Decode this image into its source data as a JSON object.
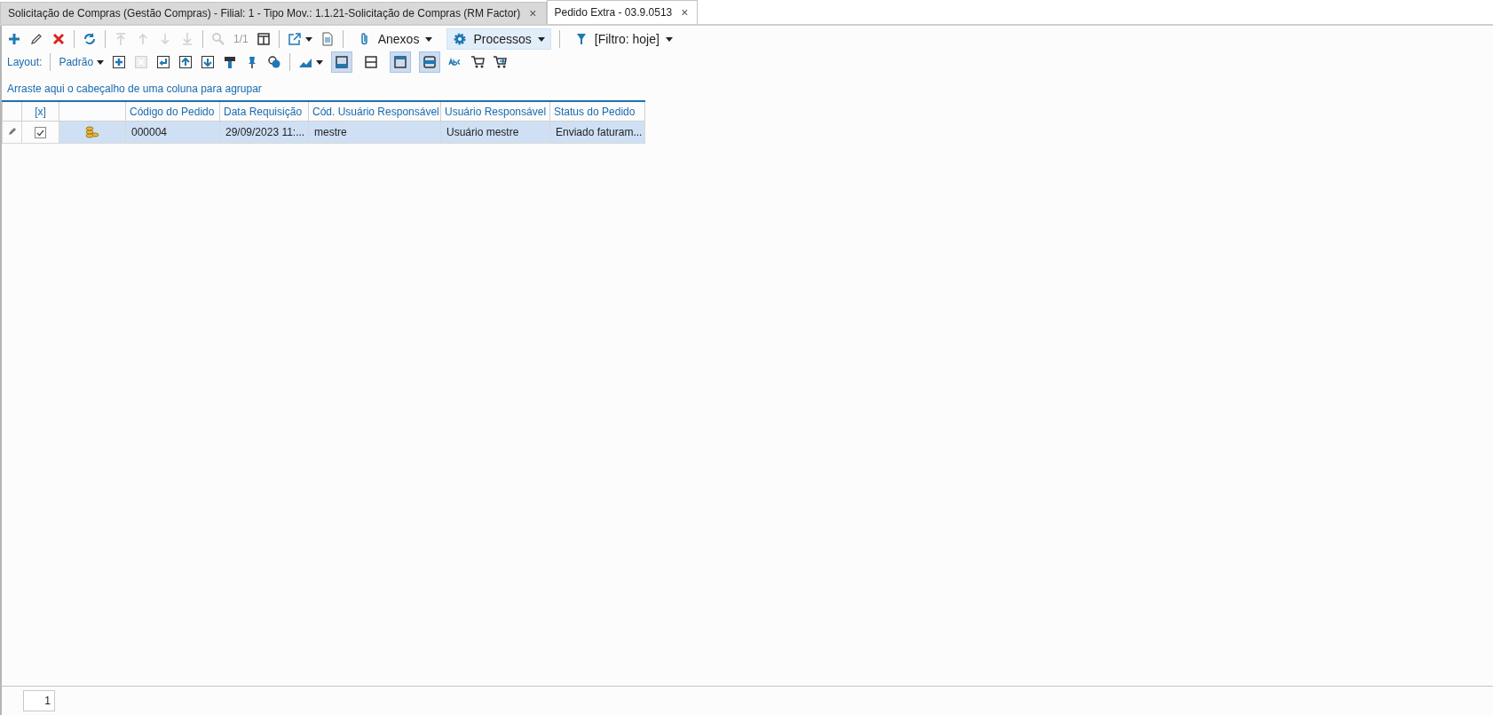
{
  "tabs": [
    {
      "label": "Solicitação de Compras (Gestão Compras) - Filial: 1 - Tipo Mov.: 1.1.21-Solicitação de Compras (RM Factor)",
      "close": "×",
      "selected": false
    },
    {
      "label": "Pedido Extra - 03.9.0513",
      "close": "×",
      "selected": true
    }
  ],
  "toolbar": [
    {
      "kind": "add",
      "disabled": false
    },
    {
      "kind": "edit",
      "disabled": false
    },
    {
      "kind": "delete",
      "disabled": false
    },
    {
      "kind": "separator"
    },
    {
      "kind": "refresh",
      "disabled": false
    },
    {
      "kind": "separator"
    },
    {
      "kind": "first",
      "disabled": true
    },
    {
      "kind": "up",
      "disabled": true
    },
    {
      "kind": "down",
      "disabled": true
    },
    {
      "kind": "last",
      "disabled": true
    },
    {
      "kind": "separator"
    },
    {
      "kind": "search",
      "disabled": true
    },
    {
      "kind": "counter",
      "text": "1/1",
      "disabled": true
    },
    {
      "kind": "columns",
      "disabled": false
    },
    {
      "kind": "separator"
    },
    {
      "kind": "export",
      "disabled": false
    },
    {
      "kind": "document",
      "disabled": false
    },
    {
      "kind": "separator"
    },
    {
      "kind": "attach-menu",
      "text": "Anexos",
      "highlighted": false
    },
    {
      "kind": "gear-menu",
      "text": "Processos",
      "highlighted": true
    },
    {
      "kind": "separator"
    },
    {
      "kind": "filter-menu",
      "text": "[Filtro: hoje]",
      "highlighted": false
    }
  ],
  "layout_bar": {
    "label": "Layout:",
    "preset": "Padrão",
    "items": [
      {
        "kind": "add-box",
        "disabled": false
      },
      {
        "kind": "remove-box",
        "disabled": true
      },
      {
        "kind": "enter-box",
        "disabled": false
      },
      {
        "kind": "up-box",
        "disabled": false
      },
      {
        "kind": "down-box",
        "disabled": false
      },
      {
        "kind": "brush",
        "disabled": false
      },
      {
        "kind": "pin",
        "disabled": false
      },
      {
        "kind": "circles",
        "disabled": false
      },
      {
        "kind": "separator"
      },
      {
        "kind": "chart",
        "disabled": false
      },
      {
        "kind": "panel-bottom",
        "selected": true
      },
      {
        "kind": "panel-split",
        "selected": false
      },
      {
        "kind": "panel-top",
        "selected": true
      },
      {
        "kind": "panel-middle",
        "selected": true
      },
      {
        "kind": "abc",
        "disabled": false
      },
      {
        "kind": "cart",
        "disabled": false
      },
      {
        "kind": "cart-arrow",
        "disabled": false
      }
    ]
  },
  "group_hint": "Arraste aqui o cabeçalho de uma coluna para agrupar",
  "table": {
    "columns": [
      {
        "kind": "blank"
      },
      {
        "kind": "text",
        "label": "[x]"
      },
      {
        "kind": "blank"
      },
      {
        "kind": "text",
        "label": "Código do Pedido"
      },
      {
        "kind": "text",
        "label": "Data Requisição"
      },
      {
        "kind": "text",
        "label": "Cód. Usuário Responsável"
      },
      {
        "kind": "text",
        "label": "Usuário Responsável"
      },
      {
        "kind": "text",
        "label": "Status do Pedido"
      }
    ],
    "rows": [
      {
        "selected": true,
        "cells": [
          {
            "kind": "pencil"
          },
          {
            "kind": "checkbox",
            "checked": true
          },
          {
            "kind": "coins"
          },
          {
            "kind": "text",
            "text": "000004"
          },
          {
            "kind": "text",
            "text": "29/09/2023 11:..."
          },
          {
            "kind": "text",
            "text": "mestre"
          },
          {
            "kind": "text",
            "text": "Usuário mestre"
          },
          {
            "kind": "text",
            "text": "Enviado faturam..."
          }
        ]
      }
    ]
  },
  "pager": {
    "page": "1"
  }
}
